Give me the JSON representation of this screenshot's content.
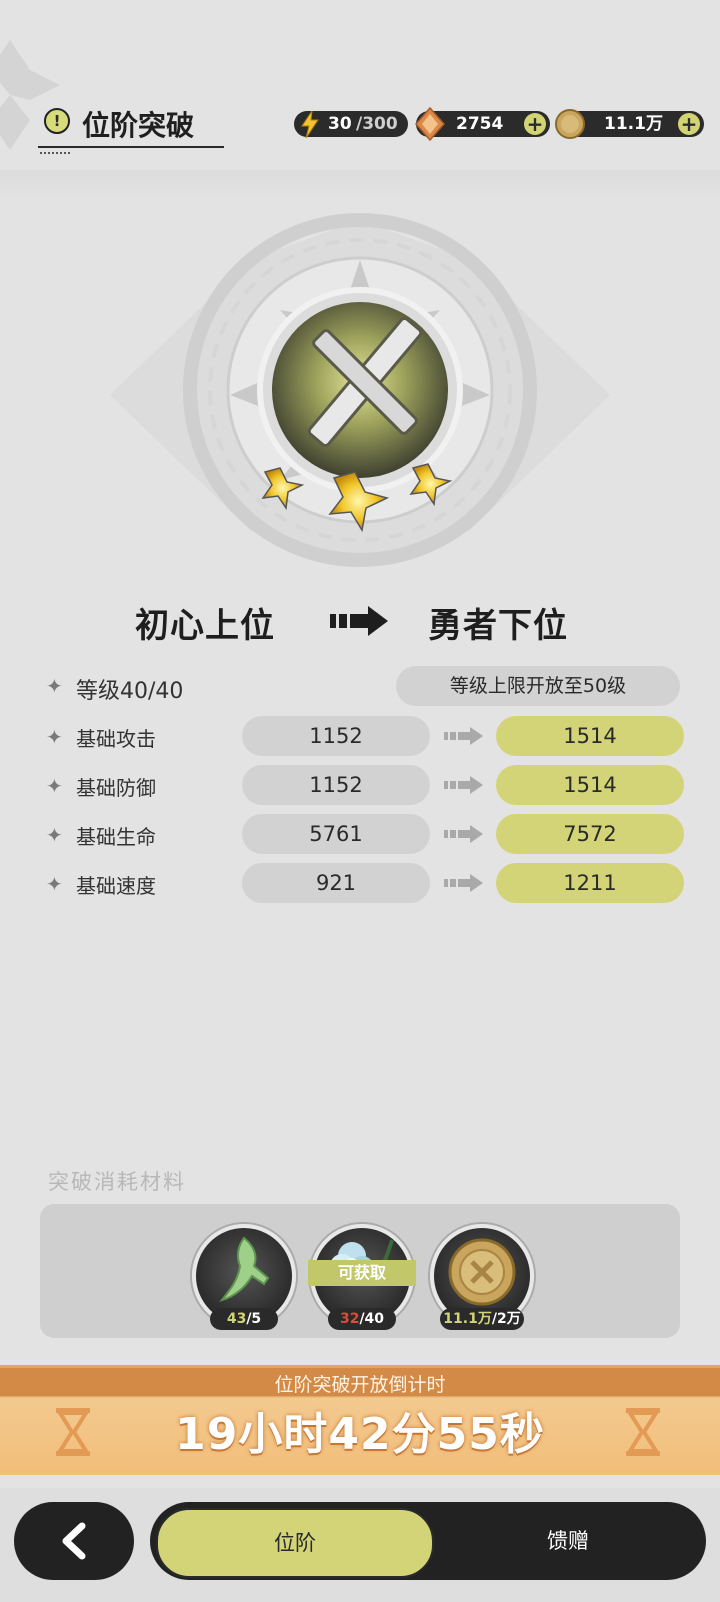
{
  "header": {
    "title": "位阶突破",
    "title_icon": "!",
    "currencies": [
      {
        "name": "energy",
        "icon": "lightning-icon",
        "value": "30",
        "max": "/300",
        "addable": false
      },
      {
        "name": "crystal",
        "icon": "crystal-icon",
        "value": "2754",
        "addable": true
      },
      {
        "name": "coin",
        "icon": "coin-icon",
        "value": "11.1万",
        "addable": true
      }
    ]
  },
  "rank": {
    "current": "初心上位",
    "next": "勇者下位",
    "stars": 3
  },
  "level": {
    "label": "等级",
    "value": "40/40",
    "cap_note": "等级上限开放至50级"
  },
  "stats": [
    {
      "label": "基础攻击",
      "current": "1152",
      "next": "1514"
    },
    {
      "label": "基础防御",
      "current": "1152",
      "next": "1514"
    },
    {
      "label": "基础生命",
      "current": "5761",
      "next": "7572"
    },
    {
      "label": "基础速度",
      "current": "921",
      "next": "1211"
    }
  ],
  "materials": {
    "title": "突破消耗材料",
    "items": [
      {
        "icon": "green-feather-icon",
        "have": "43",
        "need": "/5",
        "sufficient": true
      },
      {
        "icon": "blue-flower-icon",
        "have": "32",
        "need": "/40",
        "sufficient": false,
        "badge": "可获取"
      },
      {
        "icon": "gold-coin-icon",
        "have": "11.1万",
        "need": "/2万",
        "sufficient": true
      }
    ]
  },
  "countdown": {
    "label": "位阶突破开放倒计时",
    "time": "19小时42分55秒"
  },
  "tabs": {
    "active": "位阶",
    "other": "馈赠"
  },
  "colors": {
    "accent": "#d2d477",
    "panel": "#cfcfcf",
    "countdown": "#f2be79",
    "insufficient": "#e04a3a"
  }
}
